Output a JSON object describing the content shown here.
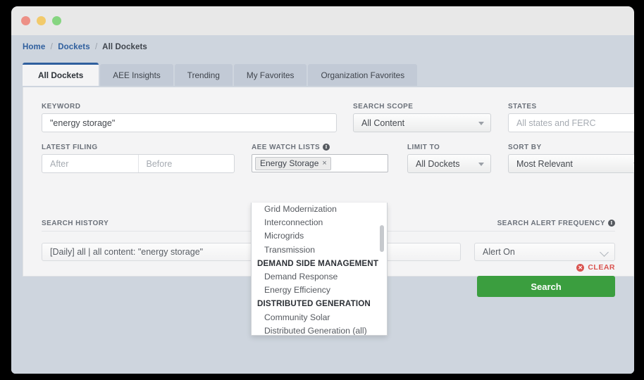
{
  "window": {
    "traffic_lights": [
      "close",
      "minimize",
      "zoom"
    ]
  },
  "breadcrumb": {
    "items": [
      "Home",
      "Dockets",
      "All Dockets"
    ],
    "separator": "/"
  },
  "tabs": [
    {
      "label": "All Dockets",
      "active": true
    },
    {
      "label": "AEE Insights",
      "active": false
    },
    {
      "label": "Trending",
      "active": false
    },
    {
      "label": "My Favorites",
      "active": false
    },
    {
      "label": "Organization Favorites",
      "active": false
    }
  ],
  "search_form": {
    "keyword": {
      "label": "KEYWORD",
      "value": "\"energy storage\""
    },
    "search_scope": {
      "label": "SEARCH SCOPE",
      "value": "All Content"
    },
    "states": {
      "label": "STATES",
      "placeholder": "All states and FERC",
      "value": ""
    },
    "latest_filing": {
      "label": "LATEST FILING",
      "after_placeholder": "After",
      "before_placeholder": "Before"
    },
    "watch_lists": {
      "label": "AEE WATCH LISTS",
      "info_icon": "info-icon",
      "selected_tag": "Energy Storage",
      "remove_glyph": "×"
    },
    "limit_to": {
      "label": "LIMIT TO",
      "value": "All Dockets"
    },
    "sort_by": {
      "label": "SORT BY",
      "value": "Most Relevant"
    },
    "clear": {
      "label": "CLEAR",
      "icon": "circle-x-icon",
      "glyph": "✕",
      "color": "#d9534f"
    },
    "search_button": {
      "label": "Search",
      "color": "#3b9e3f"
    }
  },
  "watch_list_dropdown": {
    "entries": [
      {
        "type": "item",
        "label": "Grid Modernization"
      },
      {
        "type": "item",
        "label": "Interconnection"
      },
      {
        "type": "item",
        "label": "Microgrids"
      },
      {
        "type": "item",
        "label": "Transmission"
      },
      {
        "type": "group",
        "label": "DEMAND SIDE MANAGEMENT"
      },
      {
        "type": "item",
        "label": "Demand Response"
      },
      {
        "type": "item",
        "label": "Energy Efficiency"
      },
      {
        "type": "group",
        "label": "DISTRIBUTED GENERATION"
      },
      {
        "type": "item",
        "label": "Community Solar"
      },
      {
        "type": "item",
        "label": "Distributed Generation (all)"
      }
    ]
  },
  "search_history": {
    "label": "SEARCH HISTORY",
    "value": "[Daily]  all | all content: \"energy storage\""
  },
  "search_alert": {
    "label": "SEARCH ALERT FREQUENCY",
    "info_icon": "info-icon",
    "value": "Alert On"
  }
}
